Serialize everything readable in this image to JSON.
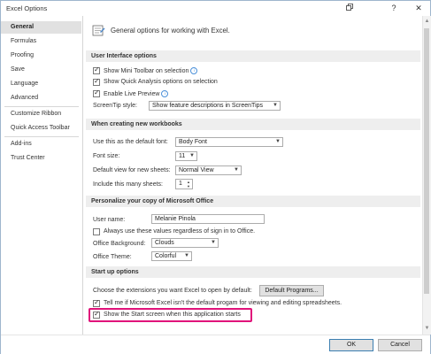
{
  "window": {
    "title": "Excel Options",
    "help_glyph": "?",
    "close_glyph": "✕"
  },
  "sidebar": {
    "items": [
      {
        "label": "General"
      },
      {
        "label": "Formulas"
      },
      {
        "label": "Proofing"
      },
      {
        "label": "Save"
      },
      {
        "label": "Language"
      },
      {
        "label": "Advanced"
      },
      {
        "label": "Customize Ribbon"
      },
      {
        "label": "Quick Access Toolbar"
      },
      {
        "label": "Add-ins"
      },
      {
        "label": "Trust Center"
      }
    ]
  },
  "main": {
    "header": "General options for working with Excel.",
    "ui_section": {
      "title": "User Interface options",
      "mini_toolbar": "Show Mini Toolbar on selection",
      "quick_analysis": "Show Quick Analysis options on selection",
      "live_preview": "Enable Live Preview",
      "screentip_label": "ScreenTip style:",
      "screentip_value": "Show feature descriptions in ScreenTips"
    },
    "workbook_section": {
      "title": "When creating new workbooks",
      "font_label": "Use this as the default font:",
      "font_value": "Body Font",
      "size_label": "Font size:",
      "size_value": "11",
      "view_label": "Default view for new sheets:",
      "view_value": "Normal View",
      "sheets_label": "Include this many sheets:",
      "sheets_value": "1"
    },
    "personalize_section": {
      "title": "Personalize your copy of Microsoft Office",
      "username_label": "User name:",
      "username_value": "Melanie Pinola",
      "always_use": "Always use these values regardless of sign in to Office.",
      "background_label": "Office Background:",
      "background_value": "Clouds",
      "theme_label": "Office Theme:",
      "theme_value": "Colorful"
    },
    "startup_section": {
      "title": "Start up options",
      "extensions_text": "Choose the extensions you want Excel to open by default:",
      "default_programs_button": "Default Programs...",
      "tell_me": "Tell me if Microsoft Excel isn't the default progam for viewing and editing spreadsheets.",
      "show_start": "Show the Start screen when this application starts"
    }
  },
  "footer": {
    "ok": "OK",
    "cancel": "Cancel"
  },
  "colors": {
    "highlight": "#e0137a",
    "section_bg": "#eeeeee",
    "nav_active": "#e1e1e1"
  }
}
